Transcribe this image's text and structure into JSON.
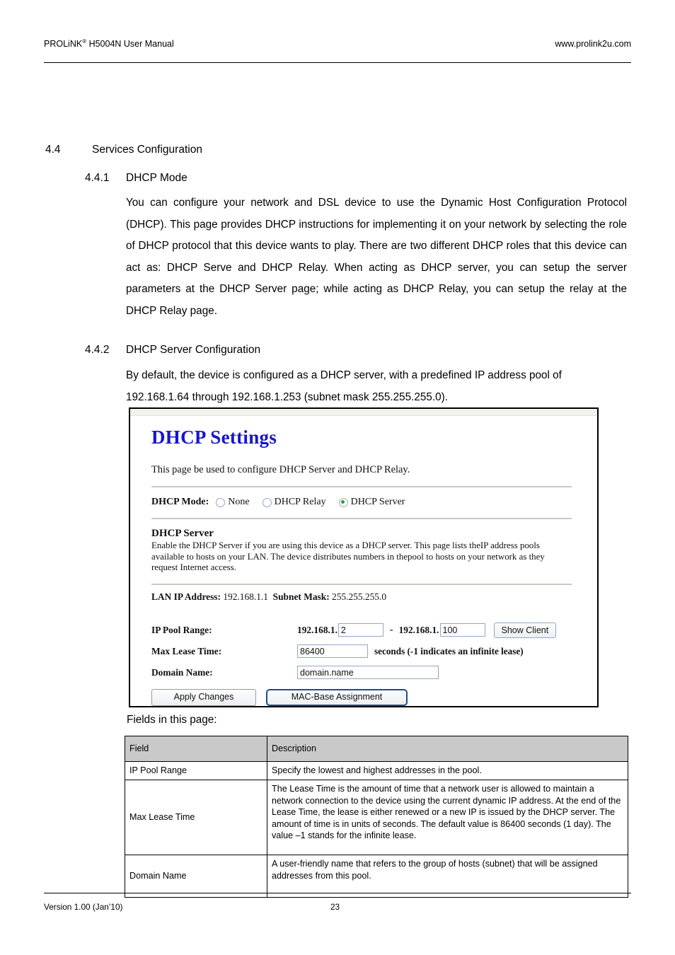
{
  "header": {
    "brand": "PROLiNK",
    "brand_sup": "®",
    "doc_title": " H5004N User Manual",
    "website": "www.prolink2u.com"
  },
  "sections": {
    "s44_number": "4.4",
    "s44_title": "Services Configuration",
    "s441_number": "4.4.1",
    "s441_title": "DHCP Mode",
    "s441_body": "You can configure your network and DSL device to use the Dynamic Host Configuration Protocol (DHCP). This page provides DHCP instructions for implementing it on your network by selecting the role of DHCP protocol that this device wants to play. There are two different DHCP roles that this device can act as: DHCP Serve and DHCP Relay. When acting as DHCP server, you can setup the server parameters at the DHCP Server page; while acting as DHCP Relay, you can setup the relay at the DHCP Relay page.",
    "s442_number": "4.4.2",
    "s442_title": "DHCP Server Configuration",
    "s442_body": "By default, the device is configured as a DHCP server, with a predefined IP address pool of 192.168.1.64 through 192.168.1.253 (subnet mask 255.255.255.0)."
  },
  "screenshot": {
    "title": "DHCP Settings",
    "intro": "This page be used to configure DHCP Server and DHCP Relay.",
    "mode_label": "DHCP Mode:",
    "mode_options": [
      {
        "label": "None",
        "selected": false
      },
      {
        "label": "DHCP Relay",
        "selected": false
      },
      {
        "label": "DHCP Server",
        "selected": true
      }
    ],
    "server_section_title": "DHCP Server",
    "server_section_body": "Enable the DHCP Server if you are using this device as a DHCP server. This page lists theIP address pools available to hosts on your LAN. The device distributes numbers in thepool to hosts on your network as they request Internet access.",
    "lan_ip_label": "LAN IP Address:",
    "lan_ip_value": "192.168.1.1",
    "subnet_label": "Subnet Mask:",
    "subnet_value": "255.255.255.0",
    "pool_label": "IP Pool Range:",
    "pool_prefix_start": "192.168.1.",
    "pool_start": "2",
    "pool_separator": "-",
    "pool_prefix_end": "192.168.1.",
    "pool_end": "100",
    "show_client_button": "Show Client",
    "lease_label": "Max Lease Time:",
    "lease_value": "86400",
    "lease_hint": "seconds (-1 indicates an infinite lease)",
    "domain_label": "Domain Name:",
    "domain_value": "domain.name",
    "apply_button": "Apply Changes",
    "mac_button": "MAC-Base Assignment",
    "accent_title_color": "#1515cc",
    "radio_selected_color": "#2f9e2f",
    "focus_border_color": "#1f4e8c"
  },
  "fields_caption": "Fields in this page:",
  "table": {
    "headers": [
      "Field",
      "Description"
    ],
    "rows": [
      {
        "field": "IP Pool Range",
        "description": "Specify the lowest and highest addresses in the pool."
      },
      {
        "field": "Max Lease Time",
        "description": "The Lease Time is the amount of time that a network user is allowed to maintain a network connection to the device using the current dynamic IP address. At the end of the Lease Time, the lease is either renewed or a new IP is issued by the DHCP server. The amount of time is in units of seconds. The default value is 86400 seconds (1 day). The value –1 stands for the infinite lease."
      },
      {
        "field": "Domain Name",
        "description": "A user-friendly name that refers to the group of hosts (subnet) that will be assigned addresses from this pool."
      }
    ],
    "header_bg": "#c9c9c9"
  },
  "footer": {
    "version": "Version 1.00 (Jan’10)",
    "page_number": "23"
  }
}
